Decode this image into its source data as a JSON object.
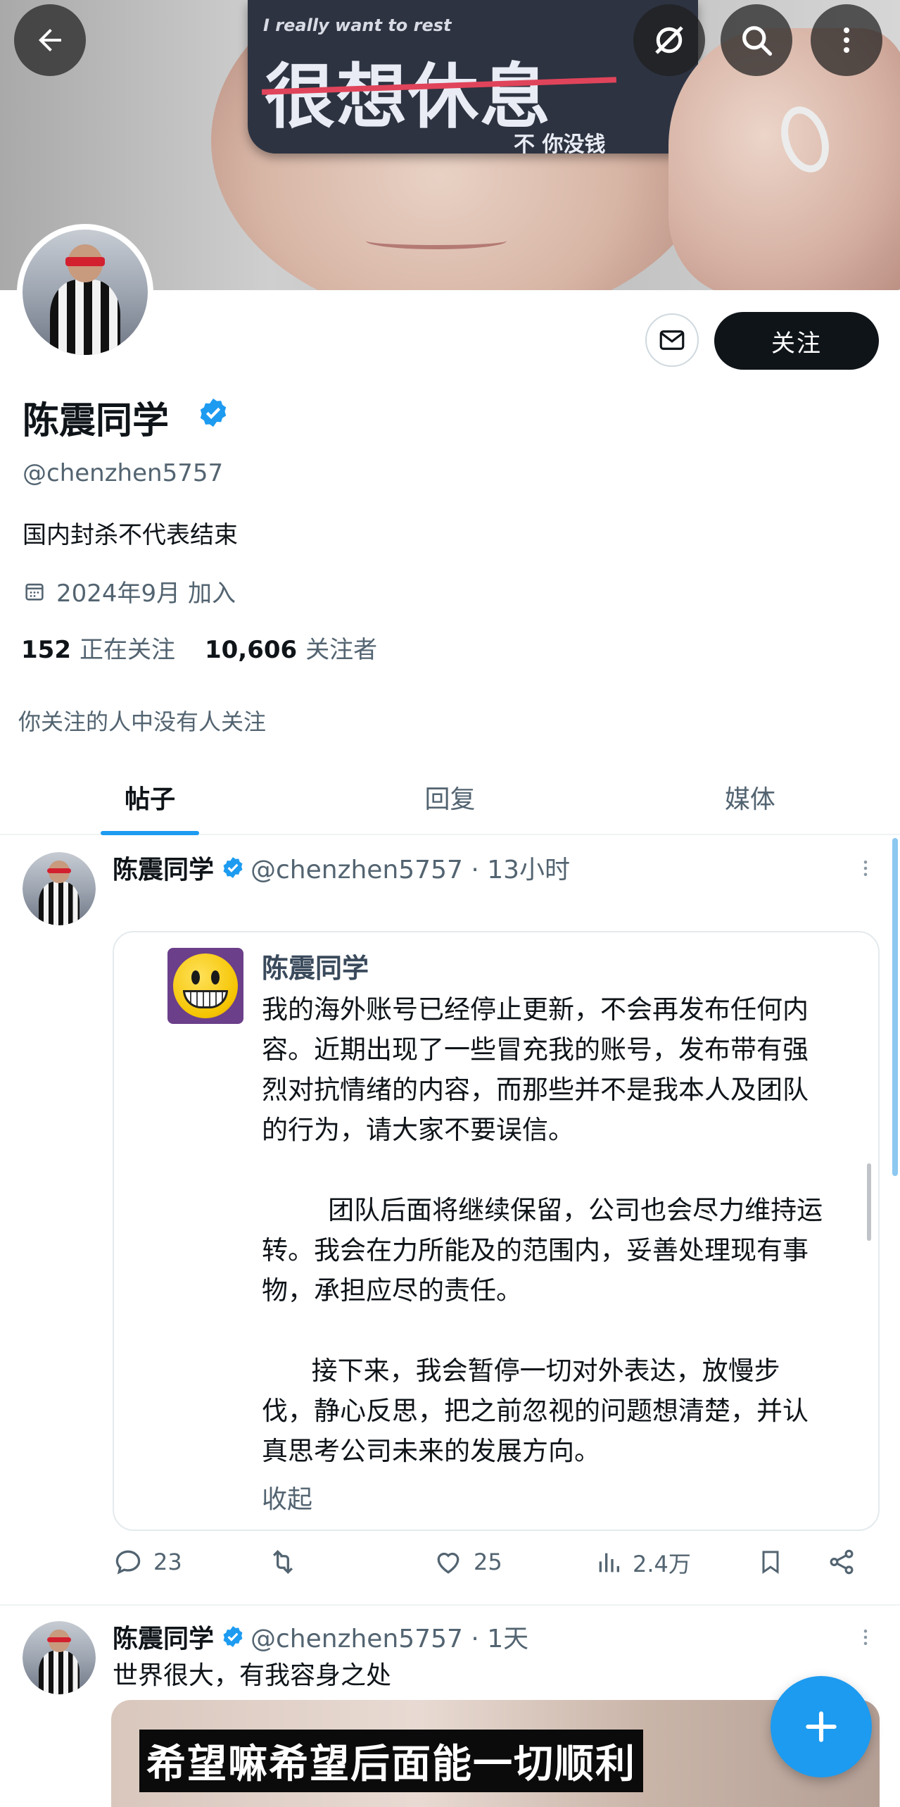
{
  "banner": {
    "overlay_en": "I really want to rest",
    "overlay_cn": "很想休息",
    "overlay_sub": "不 你没钱"
  },
  "profile": {
    "follow_label": "关注",
    "name": "陈震同学",
    "handle": "@chenzhen5757",
    "bio": "国内封杀不代表结束",
    "joined": "2024年9月 加入",
    "following_count": "152",
    "following_label": "正在关注",
    "followers_count": "10,606",
    "followers_label": "关注者",
    "known_followers": "你关注的人中没有人关注"
  },
  "tabs": [
    {
      "label": "帖子"
    },
    {
      "label": "回复"
    },
    {
      "label": "媒体"
    }
  ],
  "posts": [
    {
      "name": "陈震同学",
      "meta": "@chenzhen5757 · 13小时",
      "quote": {
        "name": "陈震同学",
        "text": "我的海外账号已经停止更新，不会再发布任何内容。近期出现了一些冒充我的账号，发布带有强烈对抗情绪的内容，而那些并不是我本人及团队的行为，请大家不要误信。\n\n        团队后面将继续保留，公司也会尽力维持运转。我会在力所能及的范围内，妥善处理现有事物，承担应尽的责任。\n\n      接下来，我会暂停一切对外表达，放慢步伐，静心反思，把之前忽视的问题想清楚，并认真思考公司未来的发展方向。",
        "collapse_label": "收起"
      },
      "replies": "23",
      "likes": "25",
      "views": "2.4万"
    },
    {
      "name": "陈震同学",
      "meta": "@chenzhen5757 · 1天",
      "text": "世界很大，有我容身之处",
      "media_subtitle": "希望嘛希望后面能一切顺利"
    }
  ],
  "colors": {
    "accent": "#1d9bf0",
    "text": "#0f1419",
    "muted": "#536471"
  }
}
